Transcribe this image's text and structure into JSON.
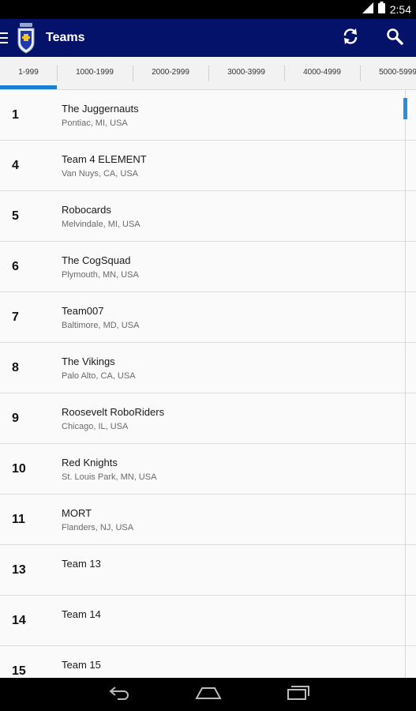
{
  "status_bar": {
    "time": "2:54",
    "icons": [
      "signal-icon",
      "battery-icon"
    ]
  },
  "action_bar": {
    "title": "Teams",
    "background": "#05126a",
    "icons": [
      "menu-icon",
      "app-logo",
      "refresh-icon",
      "search-icon"
    ]
  },
  "tabs": [
    {
      "label": "1-999",
      "selected": true
    },
    {
      "label": "1000-1999",
      "selected": false
    },
    {
      "label": "2000-2999",
      "selected": false
    },
    {
      "label": "3000-3999",
      "selected": false
    },
    {
      "label": "4000-4999",
      "selected": false
    },
    {
      "label": "5000-5999",
      "selected": false
    }
  ],
  "accent_color": "#1a7fd0",
  "teams": [
    {
      "number": "1",
      "name": "The Juggernauts",
      "location": "Pontiac, MI, USA"
    },
    {
      "number": "4",
      "name": "Team 4 ELEMENT",
      "location": "Van Nuys, CA, USA"
    },
    {
      "number": "5",
      "name": "Robocards",
      "location": "Melvindale, MI, USA"
    },
    {
      "number": "6",
      "name": "The CogSquad",
      "location": "Plymouth, MN, USA"
    },
    {
      "number": "7",
      "name": "Team007",
      "location": "Baltimore, MD, USA"
    },
    {
      "number": "8",
      "name": "The Vikings",
      "location": "Palo Alto, CA, USA"
    },
    {
      "number": "9",
      "name": "Roosevelt RoboRiders",
      "location": "Chicago, IL, USA"
    },
    {
      "number": "10",
      "name": "Red Knights",
      "location": "St. Louis Park, MN, USA"
    },
    {
      "number": "11",
      "name": "MORT",
      "location": "Flanders, NJ, USA"
    },
    {
      "number": "13",
      "name": "Team 13",
      "location": ""
    },
    {
      "number": "14",
      "name": "Team 14",
      "location": ""
    },
    {
      "number": "15",
      "name": "Team 15",
      "location": ""
    }
  ],
  "nav_bar": {
    "icons": [
      "back-icon",
      "home-icon",
      "recent-apps-icon"
    ]
  }
}
